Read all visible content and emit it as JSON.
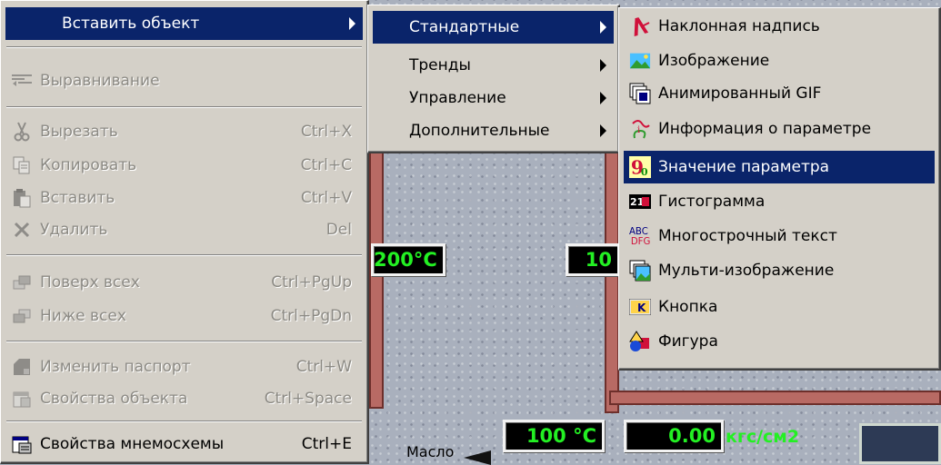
{
  "main_menu": {
    "items": [
      {
        "label": "Вставить объект",
        "shortcut": "",
        "icon": "none",
        "state": "highlighted",
        "has_submenu": true
      },
      {
        "label": "Выравнивание",
        "shortcut": "",
        "icon": "align-icon",
        "state": "disabled",
        "has_submenu": false
      },
      {
        "label": "Вырезать",
        "shortcut": "Ctrl+X",
        "icon": "cut-icon",
        "state": "disabled",
        "has_submenu": false
      },
      {
        "label": "Копировать",
        "shortcut": "Ctrl+C",
        "icon": "copy-icon",
        "state": "disabled",
        "has_submenu": false
      },
      {
        "label": "Вставить",
        "shortcut": "Ctrl+V",
        "icon": "paste-icon",
        "state": "disabled",
        "has_submenu": false
      },
      {
        "label": "Удалить",
        "shortcut": "Del",
        "icon": "delete-icon",
        "state": "disabled",
        "has_submenu": false
      },
      {
        "label": "Поверх всех",
        "shortcut": "Ctrl+PgUp",
        "icon": "bring-to-front-icon",
        "state": "disabled",
        "has_submenu": false
      },
      {
        "label": "Ниже всех",
        "shortcut": "Ctrl+PgDn",
        "icon": "send-to-back-icon",
        "state": "disabled",
        "has_submenu": false
      },
      {
        "label": "Изменить паспорт",
        "shortcut": "Ctrl+W",
        "icon": "passport-icon",
        "state": "disabled",
        "has_submenu": false
      },
      {
        "label": "Свойства объекта",
        "shortcut": "Ctrl+Space",
        "icon": "object-properties-icon",
        "state": "disabled",
        "has_submenu": false
      },
      {
        "label": "Свойства мнемосхемы",
        "shortcut": "Ctrl+E",
        "icon": "mnemonic-properties-icon",
        "state": "enabled",
        "has_submenu": false
      }
    ]
  },
  "submenu_categories": {
    "items": [
      {
        "label": "Стандартные",
        "state": "highlighted",
        "has_submenu": true
      },
      {
        "label": "Тренды",
        "state": "enabled",
        "has_submenu": true
      },
      {
        "label": "Управление",
        "state": "enabled",
        "has_submenu": true
      },
      {
        "label": "Дополнительные",
        "state": "enabled",
        "has_submenu": true
      }
    ]
  },
  "submenu_standard": {
    "items": [
      {
        "label": "Наклонная надпись",
        "icon": "slanted-text-icon",
        "state": "enabled"
      },
      {
        "label": "Изображение",
        "icon": "image-icon",
        "state": "enabled"
      },
      {
        "label": "Анимированный GIF",
        "icon": "animated-gif-icon",
        "state": "enabled"
      },
      {
        "label": "Информация о параметре",
        "icon": "parameter-info-icon",
        "state": "enabled"
      },
      {
        "label": "Значение параметра",
        "icon": "parameter-value-icon",
        "state": "highlighted"
      },
      {
        "label": "Гистограмма",
        "icon": "histogram-icon",
        "state": "enabled"
      },
      {
        "label": "Многострочный текст",
        "icon": "multiline-text-icon",
        "state": "enabled"
      },
      {
        "label": "Мульти-изображение",
        "icon": "multi-image-icon",
        "state": "enabled"
      },
      {
        "label": "Кнопка",
        "icon": "button-icon",
        "state": "enabled"
      },
      {
        "label": "Фигура",
        "icon": "shape-icon",
        "state": "enabled"
      }
    ]
  },
  "background_scheme": {
    "gauges": [
      "200°C",
      "10",
      "100 °C",
      "0.00"
    ],
    "unit_label": "кгс/см2",
    "oil_label": "Масло"
  },
  "colors": {
    "menu_face": "#d4d0c8",
    "highlight": "#0a246a",
    "highlight_text": "#ffffff",
    "disabled_text": "#8c8a84",
    "gauge_text": "#23f023",
    "pipe": "#b86a64"
  }
}
